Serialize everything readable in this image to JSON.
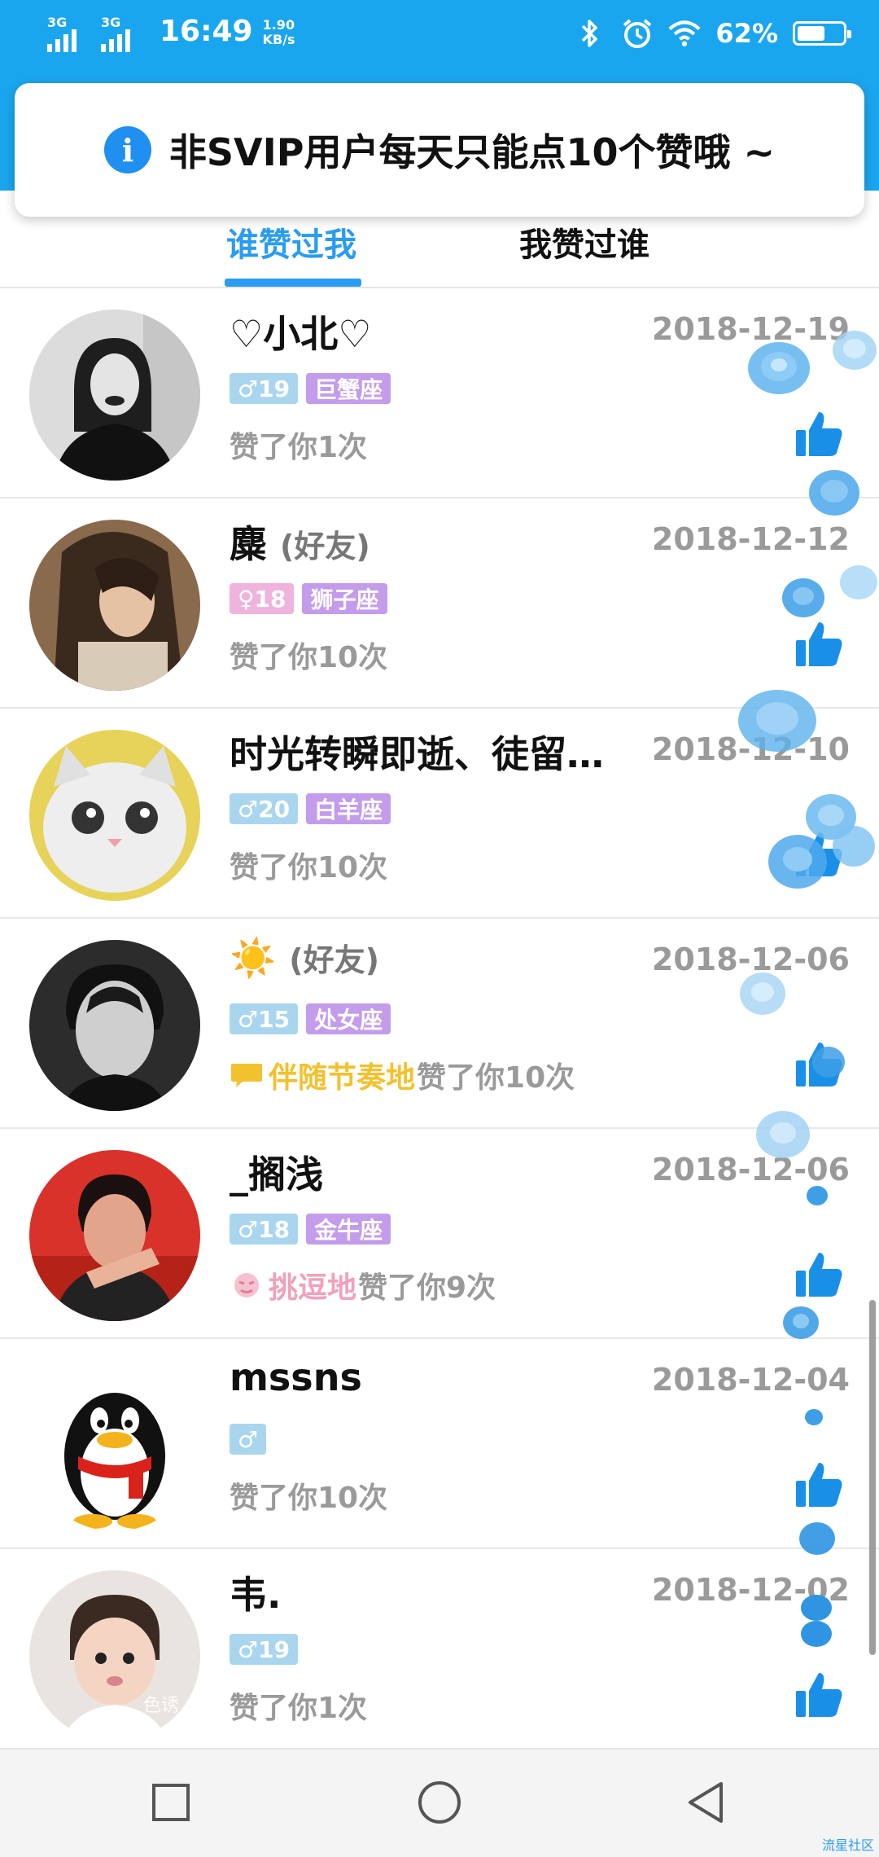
{
  "status_bar": {
    "signal_1": "3G",
    "signal_2": "3G",
    "time": "16:49",
    "speed_value": "1.90",
    "speed_unit": "KB/s",
    "battery": "62%",
    "battery_level": 0.62,
    "icons": [
      "bluetooth-icon",
      "alarm-icon",
      "wifi-icon",
      "battery-icon"
    ]
  },
  "toast": {
    "icon": "info-icon",
    "text": "非SVIP用户每天只能点10个赞哦 ~"
  },
  "tabs": [
    {
      "label": "谁赞过我",
      "active": true
    },
    {
      "label": "我赞过谁",
      "active": false
    }
  ],
  "rows": [
    {
      "name": "♡小北♡",
      "friend": "",
      "date": "2018-12-19",
      "gender": "male",
      "gender_symbol": "♂",
      "age": "19",
      "zodiac": "巨蟹座",
      "tone": "",
      "liked": "赞了你1次"
    },
    {
      "name": "麋",
      "friend": "(好友)",
      "date": "2018-12-12",
      "gender": "female",
      "gender_symbol": "♀",
      "age": "18",
      "zodiac": "狮子座",
      "tone": "",
      "liked": "赞了你10次"
    },
    {
      "name": "时光转瞬即逝、徒留…",
      "friend": "",
      "date": "2018-12-10",
      "gender": "male",
      "gender_symbol": "♂",
      "age": "20",
      "zodiac": "白羊座",
      "tone": "",
      "liked": "赞了你10次"
    },
    {
      "name": "☀️",
      "friend": "(好友)",
      "date": "2018-12-06",
      "gender": "male",
      "gender_symbol": "♂",
      "age": "15",
      "zodiac": "处女座",
      "tone": "伴随节奏地",
      "liked": "赞了你10次"
    },
    {
      "name": "_搁浅",
      "friend": "",
      "date": "2018-12-06",
      "gender": "male",
      "gender_symbol": "♂",
      "age": "18",
      "zodiac": "金牛座",
      "tone": "挑逗地",
      "liked": "赞了你9次"
    },
    {
      "name": "mssns",
      "friend": "",
      "date": "2018-12-04",
      "gender": "male",
      "gender_symbol": "♂",
      "age": "",
      "zodiac": "",
      "tone": "",
      "liked": "赞了你10次"
    },
    {
      "name": "韦.",
      "friend": "",
      "date": "2018-12-02",
      "gender": "male",
      "gender_symbol": "♂",
      "age": "19",
      "zodiac": "",
      "tone": "",
      "liked": "赞了你1次"
    }
  ],
  "avatar_watermark": "色诱",
  "nav": [
    "recents-button",
    "home-button",
    "back-button"
  ],
  "watermark": "流星社区",
  "colors": {
    "brand_blue": "#1aa6ee",
    "tab_active": "#2a9cf1",
    "male_badge": "#a9d6ee",
    "female_badge": "#efb4dd",
    "zodiac_badge": "#c39ceb",
    "tone_yellow": "#f2c12e",
    "tone_pink": "#f0a2b8"
  }
}
